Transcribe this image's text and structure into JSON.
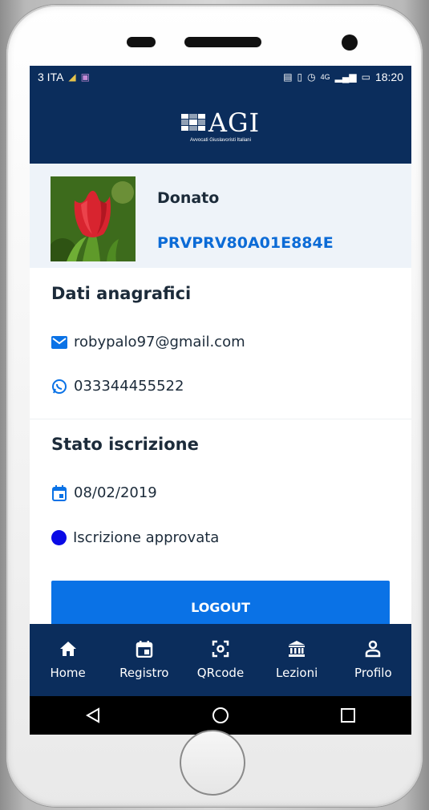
{
  "statusbar": {
    "carrier": "3 ITA",
    "time": "18:20",
    "network": "4G"
  },
  "header": {
    "logo_text": "AGI",
    "logo_subtitle": "Avvocati Giuslavoristi Italiani"
  },
  "profile": {
    "name": "Donato",
    "code": "PRVPRV80A01E884E"
  },
  "anagrafici": {
    "title": "Dati anagrafici",
    "email": "robypalo97@gmail.com",
    "phone": "033344455522"
  },
  "iscrizione": {
    "title": "Stato iscrizione",
    "date": "08/02/2019",
    "status": "Iscrizione approvata",
    "status_color": "#0a0ae6"
  },
  "logout_label": "LOGOUT",
  "tabs": [
    {
      "label": "Home",
      "icon": "home-icon"
    },
    {
      "label": "Registro",
      "icon": "calendar-icon"
    },
    {
      "label": "QRcode",
      "icon": "qrcode-scan-icon"
    },
    {
      "label": "Lezioni",
      "icon": "institution-icon"
    },
    {
      "label": "Profilo",
      "icon": "user-icon"
    }
  ],
  "colors": {
    "primary": "#0b2d5c",
    "accent": "#0a72e6",
    "link": "#0c6bd6"
  }
}
